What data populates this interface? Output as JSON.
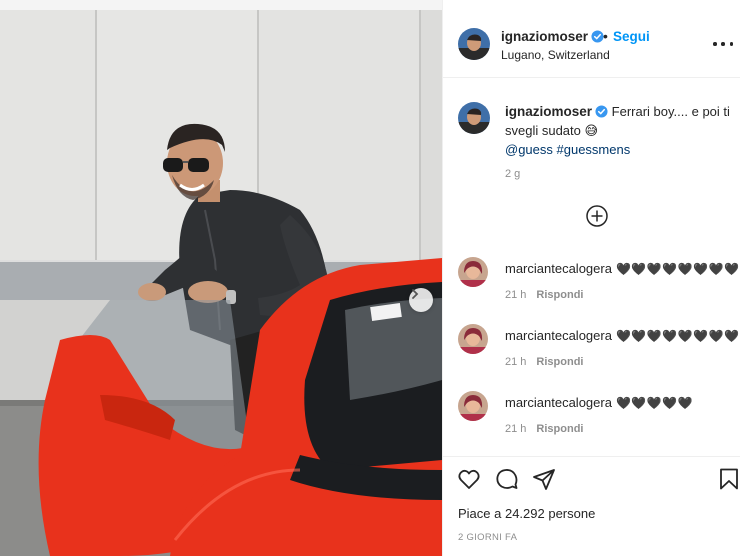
{
  "post": {
    "username": "ignaziomoser",
    "follow_label": "Segui",
    "separator": "•",
    "location": "Lugano, Switzerland",
    "caption": {
      "username": "ignaziomoser",
      "text": "Ferrari boy.... e poi ti svegli sudato 😅",
      "tags": [
        "@guess",
        "#guessmens"
      ]
    },
    "time_ago": "2 g",
    "likes_text": "Piace a 24.292 persone",
    "date_text": "2 GIORNI FA"
  },
  "comments": [
    {
      "username": "marciantecalogera",
      "hearts": "🖤🖤🖤🖤🖤🖤🖤🖤",
      "time": "21 h",
      "reply_label": "Rispondi"
    },
    {
      "username": "marciantecalogera",
      "hearts": "🖤🖤🖤🖤🖤🖤🖤🖤",
      "time": "21 h",
      "reply_label": "Rispondi"
    },
    {
      "username": "marciantecalogera",
      "hearts": "🖤🖤🖤🖤🖤",
      "time": "21 h",
      "reply_label": "Rispondi"
    }
  ],
  "icons": {
    "verified": "verified-badge-icon",
    "more": "more-options-icon",
    "load_more": "plus-circle-icon",
    "like": "heart-icon",
    "comment": "comment-bubble-icon",
    "share": "paper-plane-icon",
    "save": "bookmark-icon",
    "carousel_next": "chevron-right-icon"
  },
  "colors": {
    "link": "#0095f6",
    "hashtag": "#00376b",
    "muted": "#8e8e8e",
    "car": "#e8321c"
  }
}
